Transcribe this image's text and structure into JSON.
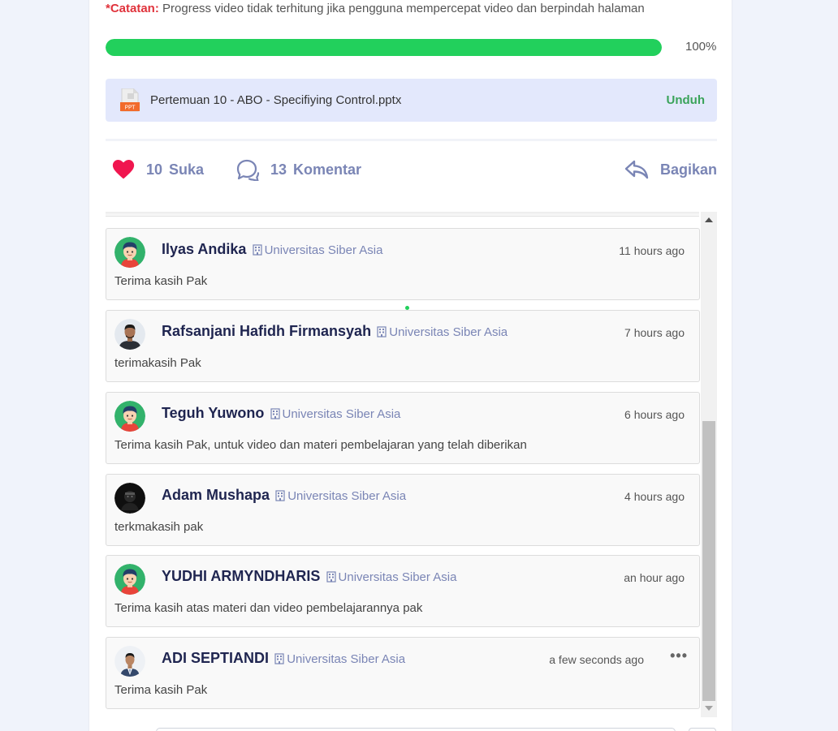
{
  "note": {
    "label": "*Catatan:",
    "text": " Progress video tidak terhitung jika pengguna mempercepat video dan berpindah halaman"
  },
  "progress": {
    "value": 100,
    "label": "100%"
  },
  "file": {
    "icon": "ppt-file-icon",
    "icon_text": "PPT",
    "name": "Pertemuan 10 - ABO - Specifiying Control.pptx",
    "download_label": "Unduh"
  },
  "actions": {
    "like_count": "10",
    "like_label": "Suka",
    "comment_count": "13",
    "comment_label": "Komentar",
    "share_label": "Bagikan"
  },
  "colors": {
    "accent": "#7a85b5",
    "progress": "#22d05c",
    "heart": "#f0164f",
    "download": "#3aa35a",
    "note_label": "#e0323b",
    "name": "#1f2550"
  },
  "comments": [
    {
      "name": "Ilyas Andika",
      "org": "Universitas Siber Asia",
      "time": "11 hours ago",
      "text": "Terima kasih Pak",
      "avatar": "cartoon"
    },
    {
      "name": "Rafsanjani Hafidh Firmansyah",
      "org": "Universitas Siber Asia",
      "time": "7 hours ago",
      "text": "terimakasih Pak",
      "avatar": "photo-man"
    },
    {
      "name": "Teguh Yuwono",
      "org": "Universitas Siber Asia",
      "time": "6 hours ago",
      "text": "Terima kasih Pak, untuk video dan materi pembelajaran yang telah diberikan",
      "avatar": "cartoon"
    },
    {
      "name": "Adam Mushapa",
      "org": "Universitas Siber Asia",
      "time": "4 hours ago",
      "text": "terkmakasih pak",
      "avatar": "dark"
    },
    {
      "name": "YUDHI ARMYNDHARIS",
      "org": "Universitas Siber Asia",
      "time": "an hour ago",
      "text": "Terima kasih atas materi dan video pembelajarannya pak",
      "avatar": "cartoon"
    },
    {
      "name": "ADI SEPTIANDI",
      "org": "Universitas Siber Asia",
      "time": "a few seconds ago",
      "text": "Terima kasih Pak",
      "avatar": "photo-suit",
      "menu": "•••"
    }
  ]
}
